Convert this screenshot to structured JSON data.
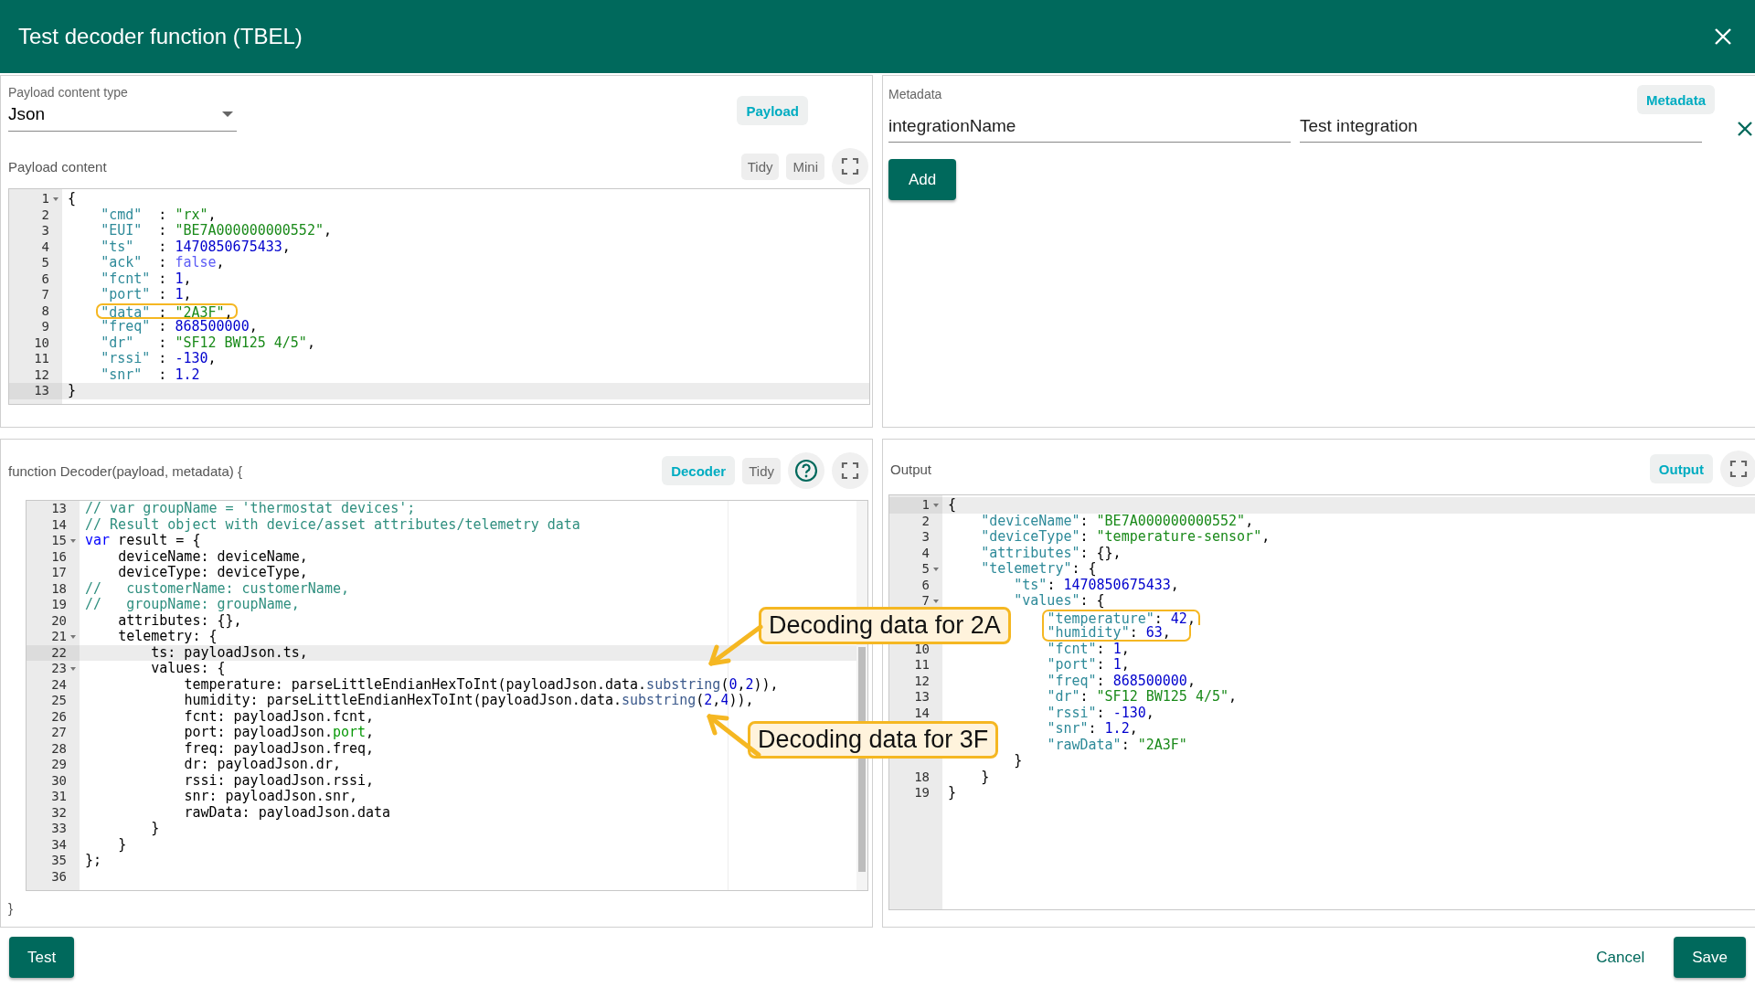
{
  "dialog": {
    "title": "Test decoder function (TBEL)"
  },
  "payload": {
    "type_label": "Payload content type",
    "type_value": "Json",
    "chip": "Payload",
    "content_label": "Payload content",
    "buttons": [
      "Tidy",
      "Mini"
    ],
    "lines": [
      {
        "n": "1",
        "fold": true,
        "active": false,
        "boxed": false,
        "tokens": [
          {
            "text": "{",
            "kind": "plain"
          }
        ]
      },
      {
        "n": "2",
        "fold": false,
        "active": false,
        "boxed": false,
        "tokens": [
          {
            "text": "    \"cmd\"",
            "kind": "key"
          },
          {
            "text": "  : ",
            "kind": "plain"
          },
          {
            "text": "\"rx\"",
            "kind": "str"
          },
          {
            "text": ",",
            "kind": "plain"
          }
        ]
      },
      {
        "n": "3",
        "fold": false,
        "active": false,
        "boxed": false,
        "tokens": [
          {
            "text": "    \"EUI\"",
            "kind": "key"
          },
          {
            "text": "  : ",
            "kind": "plain"
          },
          {
            "text": "\"BE7A000000000552\"",
            "kind": "str"
          },
          {
            "text": ",",
            "kind": "plain"
          }
        ]
      },
      {
        "n": "4",
        "fold": false,
        "active": false,
        "boxed": false,
        "tokens": [
          {
            "text": "    \"ts\"",
            "kind": "key"
          },
          {
            "text": "   : ",
            "kind": "plain"
          },
          {
            "text": "1470850675433",
            "kind": "num"
          },
          {
            "text": ",",
            "kind": "plain"
          }
        ]
      },
      {
        "n": "5",
        "fold": false,
        "active": false,
        "boxed": false,
        "tokens": [
          {
            "text": "    \"ack\"",
            "kind": "key"
          },
          {
            "text": "  : ",
            "kind": "plain"
          },
          {
            "text": "false",
            "kind": "bool"
          },
          {
            "text": ",",
            "kind": "plain"
          }
        ]
      },
      {
        "n": "6",
        "fold": false,
        "active": false,
        "boxed": false,
        "tokens": [
          {
            "text": "    \"fcnt\"",
            "kind": "key"
          },
          {
            "text": " : ",
            "kind": "plain"
          },
          {
            "text": "1",
            "kind": "num"
          },
          {
            "text": ",",
            "kind": "plain"
          }
        ]
      },
      {
        "n": "7",
        "fold": false,
        "active": false,
        "boxed": false,
        "tokens": [
          {
            "text": "    \"port\"",
            "kind": "key"
          },
          {
            "text": " : ",
            "kind": "plain"
          },
          {
            "text": "1",
            "kind": "num"
          },
          {
            "text": ",",
            "kind": "plain"
          }
        ]
      },
      {
        "n": "8",
        "fold": false,
        "active": false,
        "boxed": true,
        "tokens": [
          {
            "text": "    \"data\"",
            "kind": "key"
          },
          {
            "text": " : ",
            "kind": "plain"
          },
          {
            "text": "\"2A3F\"",
            "kind": "str"
          },
          {
            "text": ",",
            "kind": "plain"
          }
        ]
      },
      {
        "n": "9",
        "fold": false,
        "active": false,
        "boxed": false,
        "tokens": [
          {
            "text": "    \"freq\"",
            "kind": "key"
          },
          {
            "text": " : ",
            "kind": "plain"
          },
          {
            "text": "868500000",
            "kind": "num"
          },
          {
            "text": ",",
            "kind": "plain"
          }
        ]
      },
      {
        "n": "10",
        "fold": false,
        "active": false,
        "boxed": false,
        "tokens": [
          {
            "text": "    \"dr\"",
            "kind": "key"
          },
          {
            "text": "   : ",
            "kind": "plain"
          },
          {
            "text": "\"SF12 BW125 4/5\"",
            "kind": "str"
          },
          {
            "text": ",",
            "kind": "plain"
          }
        ]
      },
      {
        "n": "11",
        "fold": false,
        "active": false,
        "boxed": false,
        "tokens": [
          {
            "text": "    \"rssi\"",
            "kind": "key"
          },
          {
            "text": " : ",
            "kind": "plain"
          },
          {
            "text": "-130",
            "kind": "num"
          },
          {
            "text": ",",
            "kind": "plain"
          }
        ]
      },
      {
        "n": "12",
        "fold": false,
        "active": false,
        "boxed": false,
        "tokens": [
          {
            "text": "    \"snr\"",
            "kind": "key"
          },
          {
            "text": "  : ",
            "kind": "plain"
          },
          {
            "text": "1.2",
            "kind": "num"
          }
        ]
      },
      {
        "n": "13",
        "fold": false,
        "active": true,
        "boxed": false,
        "tokens": [
          {
            "text": "}",
            "kind": "plain"
          }
        ]
      }
    ]
  },
  "metadata": {
    "label": "Metadata",
    "chip": "Metadata",
    "entries": [
      {
        "key": "integrationName",
        "value": "Test integration"
      }
    ],
    "add_button": "Add"
  },
  "decoder": {
    "signature": "function Decoder(payload, metadata) {",
    "chip": "Decoder",
    "buttons": [
      "Tidy"
    ],
    "closing": "}",
    "lines": [
      {
        "n": "13",
        "fold": false,
        "active": false,
        "tokens": [
          {
            "text": "// var groupName = 'thermostat devices';",
            "kind": "com"
          }
        ]
      },
      {
        "n": "14",
        "fold": false,
        "active": false,
        "tokens": [
          {
            "text": "// Result object with device/asset attributes/telemetry data",
            "kind": "com"
          }
        ]
      },
      {
        "n": "15",
        "fold": true,
        "active": false,
        "tokens": [
          {
            "text": "var",
            "kind": "kw"
          },
          {
            "text": " result = {",
            "kind": "plain"
          }
        ]
      },
      {
        "n": "16",
        "fold": false,
        "active": false,
        "tokens": [
          {
            "text": "    deviceName: deviceName,",
            "kind": "plain"
          }
        ]
      },
      {
        "n": "17",
        "fold": false,
        "active": false,
        "tokens": [
          {
            "text": "    deviceType: deviceType,",
            "kind": "plain"
          }
        ]
      },
      {
        "n": "18",
        "fold": false,
        "active": false,
        "tokens": [
          {
            "text": "//   customerName: customerName,",
            "kind": "com"
          }
        ]
      },
      {
        "n": "19",
        "fold": false,
        "active": false,
        "tokens": [
          {
            "text": "//   groupName: groupName,",
            "kind": "com"
          }
        ]
      },
      {
        "n": "20",
        "fold": false,
        "active": false,
        "tokens": [
          {
            "text": "    attributes: {},",
            "kind": "plain"
          }
        ]
      },
      {
        "n": "21",
        "fold": true,
        "active": false,
        "tokens": [
          {
            "text": "    telemetry: {",
            "kind": "plain"
          }
        ]
      },
      {
        "n": "22",
        "fold": false,
        "active": true,
        "tokens": [
          {
            "text": "        ts: payloadJson.ts,",
            "kind": "plain"
          }
        ]
      },
      {
        "n": "23",
        "fold": true,
        "active": false,
        "tokens": [
          {
            "text": "        values: {",
            "kind": "plain"
          }
        ]
      },
      {
        "n": "24",
        "fold": false,
        "active": false,
        "tokens": [
          {
            "text": "            temperature: parseLittleEndianHexToInt(payloadJson.data.",
            "kind": "plain"
          },
          {
            "text": "substring",
            "kind": "fn"
          },
          {
            "text": "(",
            "kind": "plain"
          },
          {
            "text": "0",
            "kind": "num"
          },
          {
            "text": ",",
            "kind": "plain"
          },
          {
            "text": "2",
            "kind": "num"
          },
          {
            "text": ")),",
            "kind": "plain"
          }
        ]
      },
      {
        "n": "25",
        "fold": false,
        "active": false,
        "tokens": [
          {
            "text": "            humidity: parseLittleEndianHexToInt(payloadJson.data.",
            "kind": "plain"
          },
          {
            "text": "substring",
            "kind": "fn"
          },
          {
            "text": "(",
            "kind": "plain"
          },
          {
            "text": "2",
            "kind": "num"
          },
          {
            "text": ",",
            "kind": "plain"
          },
          {
            "text": "4",
            "kind": "num"
          },
          {
            "text": ")),",
            "kind": "plain"
          }
        ]
      },
      {
        "n": "26",
        "fold": false,
        "active": false,
        "tokens": [
          {
            "text": "            fcnt: payloadJson.fcnt,",
            "kind": "plain"
          }
        ]
      },
      {
        "n": "27",
        "fold": false,
        "active": false,
        "tokens": [
          {
            "text": "            port: payloadJson.",
            "kind": "plain"
          },
          {
            "text": "port",
            "kind": "prop"
          },
          {
            "text": ",",
            "kind": "plain"
          }
        ]
      },
      {
        "n": "28",
        "fold": false,
        "active": false,
        "tokens": [
          {
            "text": "            freq: payloadJson.freq,",
            "kind": "plain"
          }
        ]
      },
      {
        "n": "29",
        "fold": false,
        "active": false,
        "tokens": [
          {
            "text": "            dr: payloadJson.dr,",
            "kind": "plain"
          }
        ]
      },
      {
        "n": "30",
        "fold": false,
        "active": false,
        "tokens": [
          {
            "text": "            rssi: payloadJson.rssi,",
            "kind": "plain"
          }
        ]
      },
      {
        "n": "31",
        "fold": false,
        "active": false,
        "tokens": [
          {
            "text": "            snr: payloadJson.snr,",
            "kind": "plain"
          }
        ]
      },
      {
        "n": "32",
        "fold": false,
        "active": false,
        "tokens": [
          {
            "text": "            rawData: payloadJson.data",
            "kind": "plain"
          }
        ]
      },
      {
        "n": "33",
        "fold": false,
        "active": false,
        "tokens": [
          {
            "text": "        }",
            "kind": "plain"
          }
        ]
      },
      {
        "n": "34",
        "fold": false,
        "active": false,
        "tokens": [
          {
            "text": "    }",
            "kind": "plain"
          }
        ]
      },
      {
        "n": "35",
        "fold": false,
        "active": false,
        "tokens": [
          {
            "text": "};",
            "kind": "plain"
          }
        ]
      },
      {
        "n": "36",
        "fold": false,
        "active": false
      }
    ]
  },
  "output": {
    "label": "Output",
    "chip": "Output",
    "lines": [
      {
        "n": "1",
        "fold": true,
        "active": true,
        "boxed": false,
        "tokens": [
          {
            "text": "{",
            "kind": "plain"
          }
        ]
      },
      {
        "n": "2",
        "fold": false,
        "active": false,
        "boxed": false,
        "tokens": [
          {
            "text": "    \"deviceName\"",
            "kind": "key"
          },
          {
            "text": ": ",
            "kind": "plain"
          },
          {
            "text": "\"BE7A000000000552\"",
            "kind": "str"
          },
          {
            "text": ",",
            "kind": "plain"
          }
        ]
      },
      {
        "n": "3",
        "fold": false,
        "active": false,
        "boxed": false,
        "tokens": [
          {
            "text": "    \"deviceType\"",
            "kind": "key"
          },
          {
            "text": ": ",
            "kind": "plain"
          },
          {
            "text": "\"temperature-sensor\"",
            "kind": "str"
          },
          {
            "text": ",",
            "kind": "plain"
          }
        ]
      },
      {
        "n": "4",
        "fold": false,
        "active": false,
        "boxed": false,
        "tokens": [
          {
            "text": "    \"attributes\"",
            "kind": "key"
          },
          {
            "text": ": {},",
            "kind": "plain"
          }
        ]
      },
      {
        "n": "5",
        "fold": true,
        "active": false,
        "boxed": false,
        "tokens": [
          {
            "text": "    \"telemetry\"",
            "kind": "key"
          },
          {
            "text": ": {",
            "kind": "plain"
          }
        ]
      },
      {
        "n": "6",
        "fold": false,
        "active": false,
        "boxed": false,
        "tokens": [
          {
            "text": "        \"ts\"",
            "kind": "key"
          },
          {
            "text": ": ",
            "kind": "plain"
          },
          {
            "text": "1470850675433",
            "kind": "num"
          },
          {
            "text": ",",
            "kind": "plain"
          }
        ]
      },
      {
        "n": "7",
        "fold": true,
        "active": false,
        "boxed": false,
        "tokens": [
          {
            "text": "        \"values\"",
            "kind": "key"
          },
          {
            "text": ": {",
            "kind": "plain"
          }
        ]
      },
      {
        "fold": false,
        "active": false,
        "boxed": true,
        "tokens": [
          {
            "text": "            \"temperature\"",
            "kind": "key"
          },
          {
            "text": ": ",
            "kind": "plain"
          },
          {
            "text": "42",
            "kind": "num"
          },
          {
            "text": ",",
            "kind": "plain"
          }
        ]
      },
      {
        "fold": false,
        "active": false,
        "boxed": true,
        "tokens": [
          {
            "text": "            \"humidity\"",
            "kind": "key"
          },
          {
            "text": ": ",
            "kind": "plain"
          },
          {
            "text": "63",
            "kind": "num"
          },
          {
            "text": ",",
            "kind": "plain"
          }
        ]
      },
      {
        "n": "10",
        "fold": false,
        "active": false,
        "boxed": false,
        "tokens": [
          {
            "text": "            \"fcnt\"",
            "kind": "key"
          },
          {
            "text": ": ",
            "kind": "plain"
          },
          {
            "text": "1",
            "kind": "num"
          },
          {
            "text": ",",
            "kind": "plain"
          }
        ]
      },
      {
        "n": "11",
        "fold": false,
        "active": false,
        "boxed": false,
        "tokens": [
          {
            "text": "            \"port\"",
            "kind": "key"
          },
          {
            "text": ": ",
            "kind": "plain"
          },
          {
            "text": "1",
            "kind": "num"
          },
          {
            "text": ",",
            "kind": "plain"
          }
        ]
      },
      {
        "n": "12",
        "fold": false,
        "active": false,
        "boxed": false,
        "tokens": [
          {
            "text": "            \"freq\"",
            "kind": "key"
          },
          {
            "text": ": ",
            "kind": "plain"
          },
          {
            "text": "868500000",
            "kind": "num"
          },
          {
            "text": ",",
            "kind": "plain"
          }
        ]
      },
      {
        "n": "13",
        "fold": false,
        "active": false,
        "boxed": false,
        "tokens": [
          {
            "text": "            \"dr\"",
            "kind": "key"
          },
          {
            "text": ": ",
            "kind": "plain"
          },
          {
            "text": "\"SF12 BW125 4/5\"",
            "kind": "str"
          },
          {
            "text": ",",
            "kind": "plain"
          }
        ]
      },
      {
        "n": "14",
        "fold": false,
        "active": false,
        "boxed": false,
        "tokens": [
          {
            "text": "            \"rssi\"",
            "kind": "key"
          },
          {
            "text": ": ",
            "kind": "plain"
          },
          {
            "text": "-130",
            "kind": "num"
          },
          {
            "text": ",",
            "kind": "plain"
          }
        ]
      },
      {
        "fold": false,
        "active": false,
        "boxed": false,
        "tokens": [
          {
            "text": "            \"snr\"",
            "kind": "key"
          },
          {
            "text": ": ",
            "kind": "plain"
          },
          {
            "text": "1.2",
            "kind": "num"
          },
          {
            "text": ",",
            "kind": "plain"
          }
        ]
      },
      {
        "fold": false,
        "active": false,
        "boxed": false,
        "tokens": [
          {
            "text": "            \"rawData\"",
            "kind": "key"
          },
          {
            "text": ": ",
            "kind": "plain"
          },
          {
            "text": "\"2A3F\"",
            "kind": "str"
          }
        ]
      },
      {
        "fold": false,
        "active": false,
        "boxed": false,
        "tokens": [
          {
            "text": "        }",
            "kind": "plain"
          }
        ]
      },
      {
        "n": "18",
        "fold": false,
        "active": false,
        "boxed": false,
        "tokens": [
          {
            "text": "    }",
            "kind": "plain"
          }
        ]
      },
      {
        "n": "19",
        "fold": false,
        "active": false,
        "boxed": false,
        "tokens": [
          {
            "text": "}",
            "kind": "plain"
          }
        ]
      }
    ]
  },
  "callouts": [
    {
      "text": "Decoding data for 2A"
    },
    {
      "text": "Decoding data for 3F"
    }
  ],
  "footer": {
    "test": "Test",
    "cancel": "Cancel",
    "save": "Save"
  }
}
